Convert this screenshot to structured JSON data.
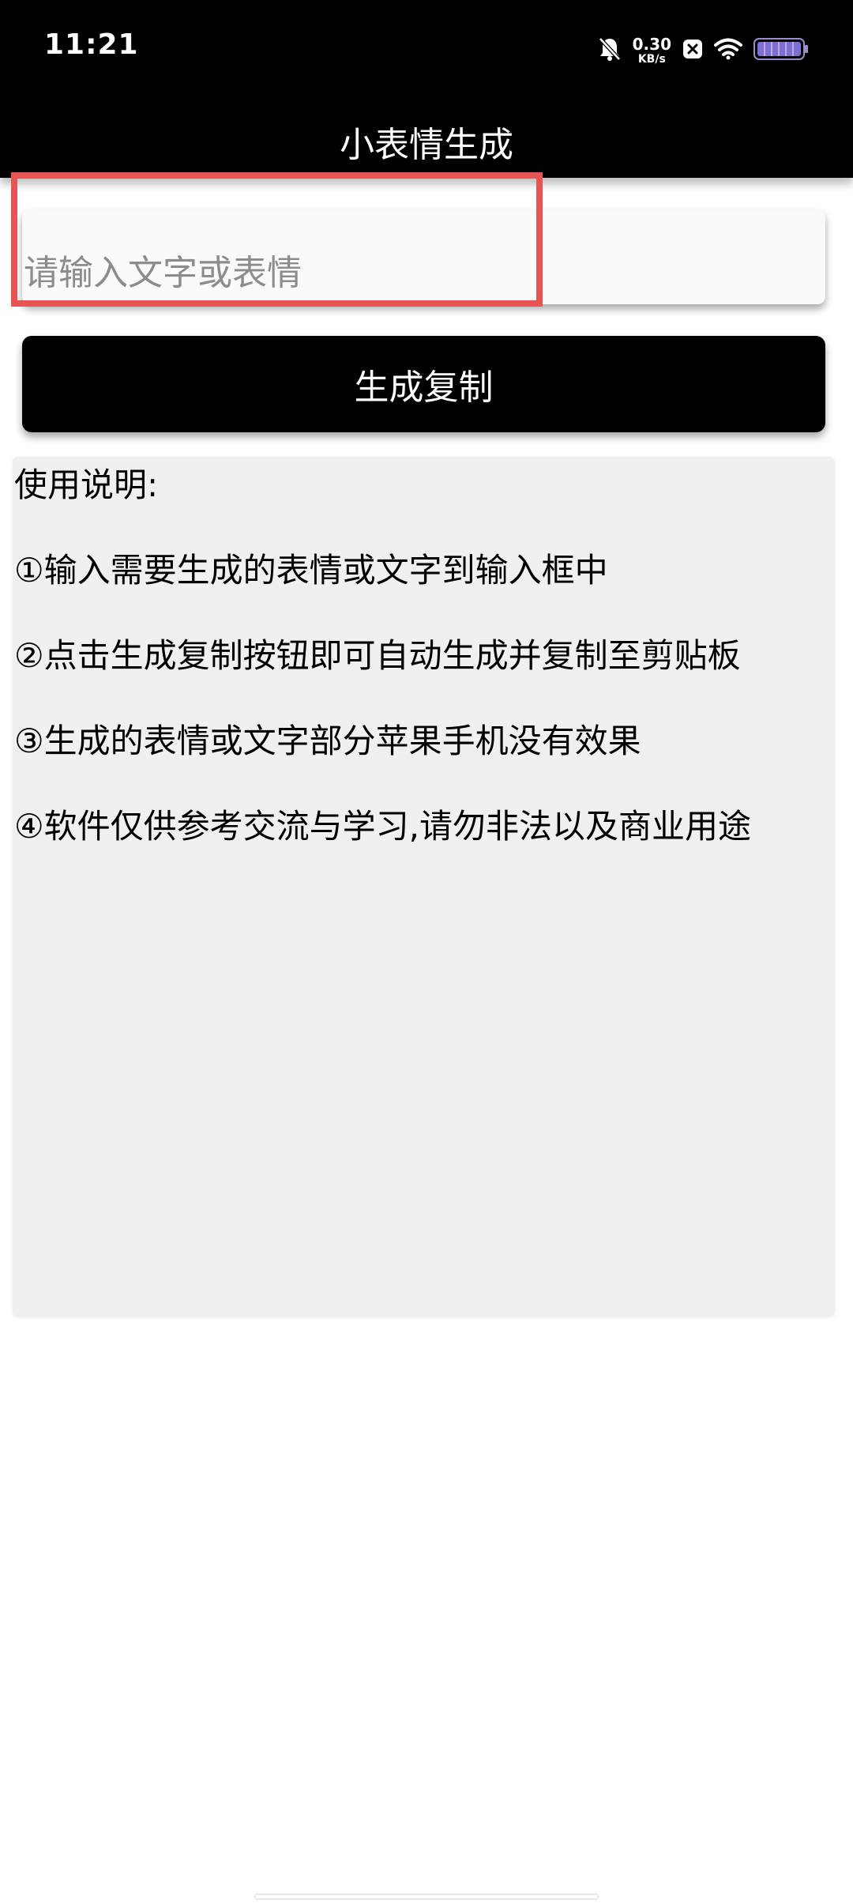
{
  "status_bar": {
    "time": "11:21",
    "net_speed_value": "0.30",
    "net_speed_unit": "KB/s",
    "icons": [
      "bell-muted-icon",
      "app-notification-icon",
      "wifi-icon",
      "battery-icon"
    ]
  },
  "header": {
    "title": "小表情生成"
  },
  "input": {
    "placeholder": "请输入文字或表情",
    "value": ""
  },
  "actions": {
    "generate_copy_label": "生成复制"
  },
  "instructions": {
    "title": "使用说明:",
    "items": [
      "①输入需要生成的表情或文字到输入框中",
      "②点击生成复制按钮即可自动生成并复制至剪贴板",
      "③生成的表情或文字部分苹果手机没有效果",
      "④软件仅供参考交流与学习,请勿非法以及商业用途"
    ]
  },
  "colors": {
    "header_bg": "#000000",
    "button_bg": "#000000",
    "panel_bg": "#f0f0f0",
    "highlight": "#e85454",
    "placeholder": "#8c8c8c"
  }
}
